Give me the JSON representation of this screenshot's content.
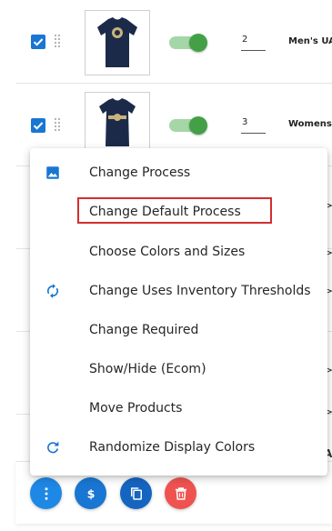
{
  "rows": [
    {
      "quantity": "2",
      "product_name": "Men's UA"
    },
    {
      "quantity": "3",
      "product_name": "Womens"
    }
  ],
  "peek_symbols": [
    ">",
    ">",
    ">",
    ">",
    ">",
    "A"
  ],
  "menu": {
    "items": [
      {
        "label": "Change Process",
        "icon": "image-icon"
      },
      {
        "label": "Change Default Process",
        "icon": ""
      },
      {
        "label": "Choose Colors and Sizes",
        "icon": ""
      },
      {
        "label": "Change Uses Inventory Thresholds",
        "icon": "sync-icon"
      },
      {
        "label": "Change Required",
        "icon": ""
      },
      {
        "label": "Show/Hide (Ecom)",
        "icon": ""
      },
      {
        "label": "Move Products",
        "icon": ""
      },
      {
        "label": "Randomize Display Colors",
        "icon": "refresh-icon"
      }
    ],
    "highlighted_item": "Change Default Process"
  },
  "toolbar": {
    "buttons": [
      {
        "name": "more-vert",
        "color": "#1e88e5"
      },
      {
        "name": "dollar",
        "color": "#1976d2"
      },
      {
        "name": "copy",
        "color": "#1565c0"
      },
      {
        "name": "delete",
        "color": "#ef5350"
      }
    ]
  },
  "colors": {
    "primary": "#1976d2",
    "toggle_on": "#43a047",
    "highlight_border": "#d32f2f"
  }
}
